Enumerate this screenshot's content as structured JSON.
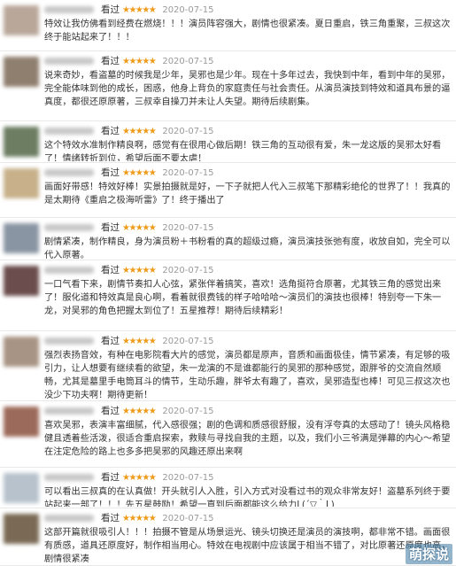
{
  "reviews": [
    {
      "status": "看过",
      "stars": "★★★★★",
      "date": "2020-07-15",
      "avatar_color": "#b9a79a",
      "text": "特效让我仿佛看到经费在燃烧！！！演员阵容强大，剧情也很紧凑。夏日重启，铁三角重聚，三叔这次终于能站起来了！！！"
    },
    {
      "status": "看过",
      "stars": "★★★★★",
      "date": "2020-07-15",
      "avatar_color": "#8f7f6f",
      "text": "说来奇妙，看盗墓的时候我是少年，吴邪也是少年。现在十多年过去，我快到中年，看到中年的吴邪，完全能体味到他的成长，困惑，他身上背负的家庭责任与社会责任。从演员演技到特效和道具布景的逼真度，都很还原原著，三叔幸自操刀并未让人失望。期待后续剧集。"
    },
    {
      "status": "看过",
      "stars": "★★★★★",
      "date": "2020-07-15",
      "avatar_color": "#6c7d62",
      "text": "这个特效水准制作精良啊，感觉有在很用心做后期！铁三角的互动很有爱，朱一龙这版的吴邪太好看了！情绪转折到位，希望后面不要太虐！"
    },
    {
      "status": "看过",
      "stars": "★★★★★",
      "date": "2020-07-15",
      "avatar_color": "#c7b08a",
      "text": "画面好带感！特效好棒！实景拍摄就是好，一下子就把人代入三叔笔下那精彩绝伦的世界了！！我真的是太期待《重启之极海听雷》了！终于播出了"
    },
    {
      "status": "看过",
      "stars": "★★★★★",
      "date": "2020-07-15",
      "avatar_color": "#8a95a3",
      "text": "剧情紧凑，制作精良，身为演员粉＋书粉看的真的超级过瘾，演员演技张弛有度，收放自如，完全可以代入原著。"
    },
    {
      "status": "看过",
      "stars": "★★★★★",
      "date": "2020-07-15",
      "avatar_color": "#6b4d4d",
      "text": "一口气看下来，剧情节奏扣人心弦，紧张伴着搞笑，喜欢！选角挺符合原著，尤其铁三角的感觉出来了！服化道和特效真是良心啊，看着就很费钱的样子哈哈哈～演员们的演技也很棒！特别夸一下朱一龙，对吴邪的角色把握太到位了！五星推荐！期待后续精彩！"
    },
    {
      "status": "看过",
      "stars": "★★★★★",
      "date": "2020-07-15",
      "avatar_color": "#a89484",
      "text": "强烈表扬音效，有种在电影院看大片的感觉，演员都是原声，音质和画面极佳，情节紧凑，有足够的吸引力，让人想要有继续看的欲望，朱一龙演的不是谁都能行的吴邪的那种感觉，跟胖爷的交流自然顺畅，尤其是墓里手电筒耳斗的情节，生动乐趣，胖爷太有趣了，喜欢，吴邪造型也棒！可见三叔这次也没少下功夫啊！期待更新！"
    },
    {
      "status": "看过",
      "stars": "★★★★★",
      "date": "2020-07-15",
      "avatar_color": "#9c6a5a",
      "text": "喜欢吴邪，表演丰富细腻，代入感很强；剧的色调和质感很舒服，没有浮夸真的太感动了！镜头风格稳健且透着些活泼，很适合重启探索，救赎与寻找自我的主题，以及，我们小三爷满是弹幕的内心～希望在注定危险的路上也多多把吴邪的风趣还原出来啊"
    },
    {
      "status": "看过",
      "stars": "★★★★★",
      "date": "2020-07-15",
      "avatar_color": "#b7c2cc",
      "text": "可以看出三叔真的在认真做！开头就引人入胜，引入方式对没看过书的观众非常友好！盗墓系列终于要站起来一部了！！！先五星鼓励！希望一直到后面都能这么给力L(´▽｀L)"
    },
    {
      "status": "看过",
      "stars": "★★★★★",
      "date": "2020-07-15",
      "avatar_color": "#7a6a55",
      "text": "这部开篇就很吸引人！！！拍摄不管是从场景运光、镜头切换还是演员的演技啊，都非常不错。画面很有质感，道具还原度好，制作相当用心。特效在电视剧中应该属于相当不错了，对比原著还原度也高，剧情很紧凑"
    }
  ],
  "watermark": {
    "text": "萌探说"
  }
}
